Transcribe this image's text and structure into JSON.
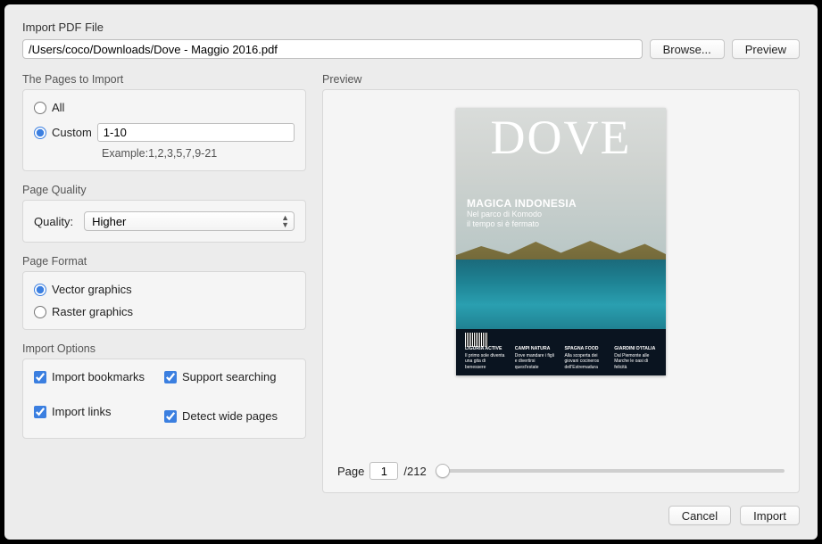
{
  "header": {
    "title": "Import PDF File",
    "filepath": "/Users/coco/Downloads/Dove - Maggio 2016.pdf",
    "browse_label": "Browse...",
    "preview_label": "Preview"
  },
  "pages": {
    "group_label": "The Pages to Import",
    "all_label": "All",
    "custom_label": "Custom",
    "custom_value": "1-10",
    "example": "Example:1,2,3,5,7,9-21",
    "selected": "custom"
  },
  "quality": {
    "group_label": "Page Quality",
    "label": "Quality:",
    "value": "Higher"
  },
  "format": {
    "group_label": "Page Format",
    "vector_label": "Vector graphics",
    "raster_label": "Raster graphics",
    "selected": "vector"
  },
  "options": {
    "group_label": "Import Options",
    "import_bookmarks": "Import bookmarks",
    "import_links": "Import links",
    "support_searching": "Support searching",
    "detect_wide": "Detect wide pages"
  },
  "preview": {
    "group_label": "Preview",
    "page_label": "Page",
    "current_page": "1",
    "total_pages": "/212"
  },
  "cover": {
    "title": "DOVE",
    "headline": "MAGICA INDONESIA",
    "sub1": "Nel parco di Komodo",
    "sub2": "il tempo si è fermato",
    "cols": [
      {
        "h": "LIGURIA ACTIVE",
        "t": "Il primo sole diventa una gita di benessere"
      },
      {
        "h": "CAMPI NATURA",
        "t": "Dove mandare i figli e divertirsi quest'estate"
      },
      {
        "h": "SPAGNA FOOD",
        "t": "Alla scoperta dei giovani cocineros dell'Estremadura"
      },
      {
        "h": "GIARDINI D'ITALIA",
        "t": "Dal Piemonte alle Marche le oasi di felicità"
      }
    ]
  },
  "footer": {
    "cancel": "Cancel",
    "import": "Import"
  }
}
